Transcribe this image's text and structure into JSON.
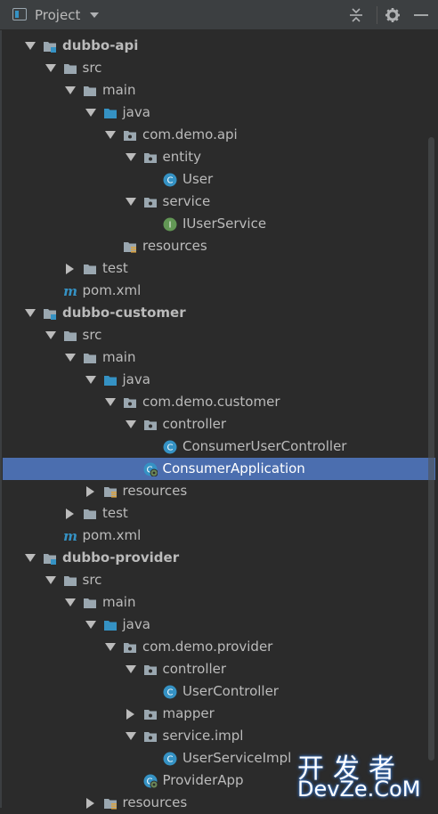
{
  "header": {
    "title": "Project",
    "icons": [
      "project-view-icon",
      "dropdown-caret-icon",
      "collapse-all-icon",
      "settings-gear-icon",
      "hide-minus-icon"
    ]
  },
  "tree": [
    {
      "label": "dubbo-api",
      "icon": "module-folder-icon",
      "arrow": "down",
      "bold": true
    },
    {
      "label": "src",
      "icon": "folder-icon",
      "arrow": "down"
    },
    {
      "label": "main",
      "icon": "folder-icon",
      "arrow": "down"
    },
    {
      "label": "java",
      "icon": "source-root-folder-icon",
      "arrow": "down"
    },
    {
      "label": "com.demo.api",
      "icon": "package-icon",
      "arrow": "down"
    },
    {
      "label": "entity",
      "icon": "package-icon",
      "arrow": "down"
    },
    {
      "label": "User",
      "icon": "class-icon",
      "arrow": "none"
    },
    {
      "label": "service",
      "icon": "package-icon",
      "arrow": "down"
    },
    {
      "label": "IUserService",
      "icon": "interface-icon",
      "arrow": "none"
    },
    {
      "label": "resources",
      "icon": "resources-folder-icon",
      "arrow": "none"
    },
    {
      "label": "test",
      "icon": "folder-icon",
      "arrow": "right"
    },
    {
      "label": "pom.xml",
      "icon": "maven-icon",
      "arrow": "none"
    },
    {
      "label": "dubbo-customer",
      "icon": "module-folder-icon",
      "arrow": "down",
      "bold": true
    },
    {
      "label": "src",
      "icon": "folder-icon",
      "arrow": "down"
    },
    {
      "label": "main",
      "icon": "folder-icon",
      "arrow": "down"
    },
    {
      "label": "java",
      "icon": "source-root-folder-icon",
      "arrow": "down"
    },
    {
      "label": "com.demo.customer",
      "icon": "package-icon",
      "arrow": "down"
    },
    {
      "label": "controller",
      "icon": "package-icon",
      "arrow": "down"
    },
    {
      "label": "ConsumerUserController",
      "icon": "class-icon",
      "arrow": "none"
    },
    {
      "label": "ConsumerApplication",
      "icon": "spring-boot-class-icon",
      "arrow": "none",
      "selected": true
    },
    {
      "label": "resources",
      "icon": "resources-folder-icon",
      "arrow": "right"
    },
    {
      "label": "test",
      "icon": "folder-icon",
      "arrow": "right"
    },
    {
      "label": "pom.xml",
      "icon": "maven-icon",
      "arrow": "none"
    },
    {
      "label": "dubbo-provider",
      "icon": "module-folder-icon",
      "arrow": "down",
      "bold": true
    },
    {
      "label": "src",
      "icon": "folder-icon",
      "arrow": "down"
    },
    {
      "label": "main",
      "icon": "folder-icon",
      "arrow": "down"
    },
    {
      "label": "java",
      "icon": "source-root-folder-icon",
      "arrow": "down"
    },
    {
      "label": "com.demo.provider",
      "icon": "package-icon",
      "arrow": "down"
    },
    {
      "label": "controller",
      "icon": "package-icon",
      "arrow": "down"
    },
    {
      "label": "UserController",
      "icon": "class-icon",
      "arrow": "none"
    },
    {
      "label": "mapper",
      "icon": "package-icon",
      "arrow": "right"
    },
    {
      "label": "service.impl",
      "icon": "package-icon",
      "arrow": "down"
    },
    {
      "label": "UserServiceImpl",
      "icon": "class-icon",
      "arrow": "none"
    },
    {
      "label": "ProviderApp",
      "icon": "spring-boot-class-icon",
      "arrow": "none"
    },
    {
      "label": "resources",
      "icon": "resources-folder-icon",
      "arrow": "right"
    }
  ],
  "watermark": {
    "chinese": "开发者",
    "english": "DevZe.CoM"
  },
  "colors": {
    "background": "#2b2b2b",
    "header": "#3c3f41",
    "selection": "#4b6eaf",
    "folder": "#9aa7b0",
    "source_root": "#3592c4",
    "class": "#3592c4",
    "interface": "#629755",
    "maven": "#3592c4"
  }
}
